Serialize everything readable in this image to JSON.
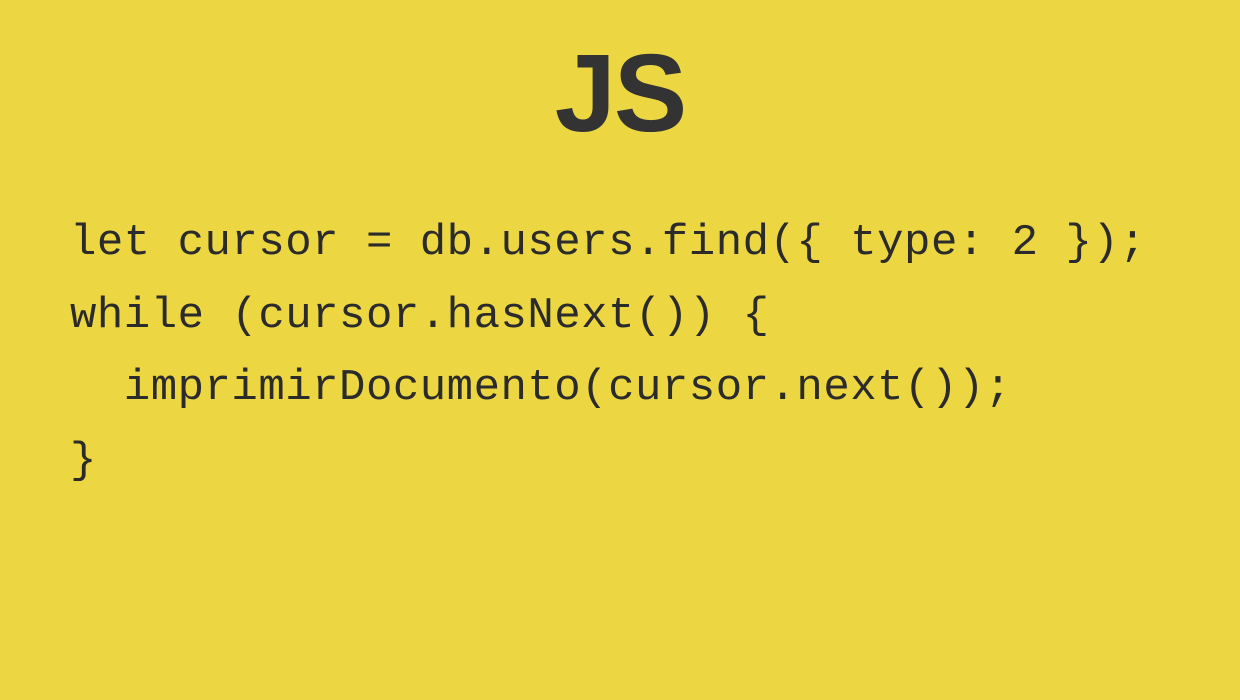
{
  "heading": "JS",
  "code": "let cursor = db.users.find({ type: 2 });\nwhile (cursor.hasNext()) {\n  imprimirDocumento(cursor.next());\n}"
}
